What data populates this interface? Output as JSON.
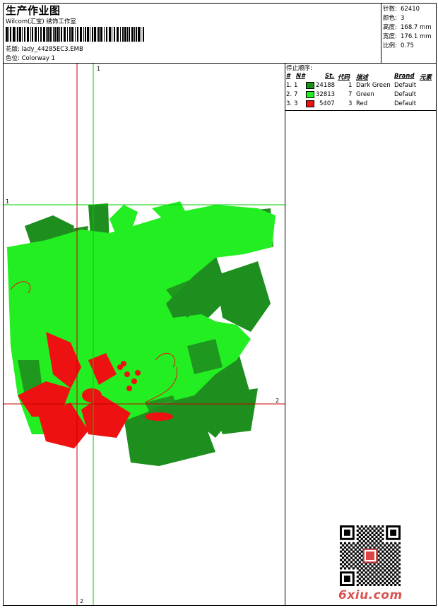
{
  "header": {
    "title": "生产作业图",
    "company": "Wilcom(汇宝) 绣饰工作室",
    "design_label": "花版:",
    "design_file": "lady_44285EC3.EMB",
    "colorway_label": "色位:",
    "colorway": "Colorway 1"
  },
  "stats": [
    {
      "label": "针数:",
      "value": "62410"
    },
    {
      "label": "颜色:",
      "value": "3"
    },
    {
      "label": "高度:",
      "value": "168.7 mm"
    },
    {
      "label": "宽度:",
      "value": "176.1 mm"
    },
    {
      "label": "比例:",
      "value": "0.75"
    }
  ],
  "stop_sequence": {
    "title": "停止顺序:",
    "headers": {
      "num": "#",
      "n": "N#",
      "stitches": "St.",
      "code": "代码",
      "desc": "描述",
      "brand": "Brand",
      "element": "元素"
    },
    "rows": [
      {
        "num": "1.",
        "n": "1",
        "color": "#1e8f1e",
        "stitches": "24188",
        "code": "1",
        "desc": "Dark Green",
        "brand": "Default"
      },
      {
        "num": "2.",
        "n": "7",
        "color": "#22ee22",
        "stitches": "32813",
        "code": "7",
        "desc": "Green",
        "brand": "Default"
      },
      {
        "num": "3.",
        "n": "3",
        "color": "#ee1111",
        "stitches": "5407",
        "code": "3",
        "desc": "Red",
        "brand": "Default"
      }
    ]
  },
  "guides": {
    "v_green": "1",
    "h_green": "1",
    "h_red": "2",
    "v_red": "2"
  },
  "watermark": {
    "logo_text": "6xiu.com"
  },
  "colors": {
    "dark_green": "#1e8f1e",
    "green": "#22ee22",
    "red": "#ee1111",
    "red_guide": "#cc0000",
    "green_guide": "#00cc00"
  }
}
